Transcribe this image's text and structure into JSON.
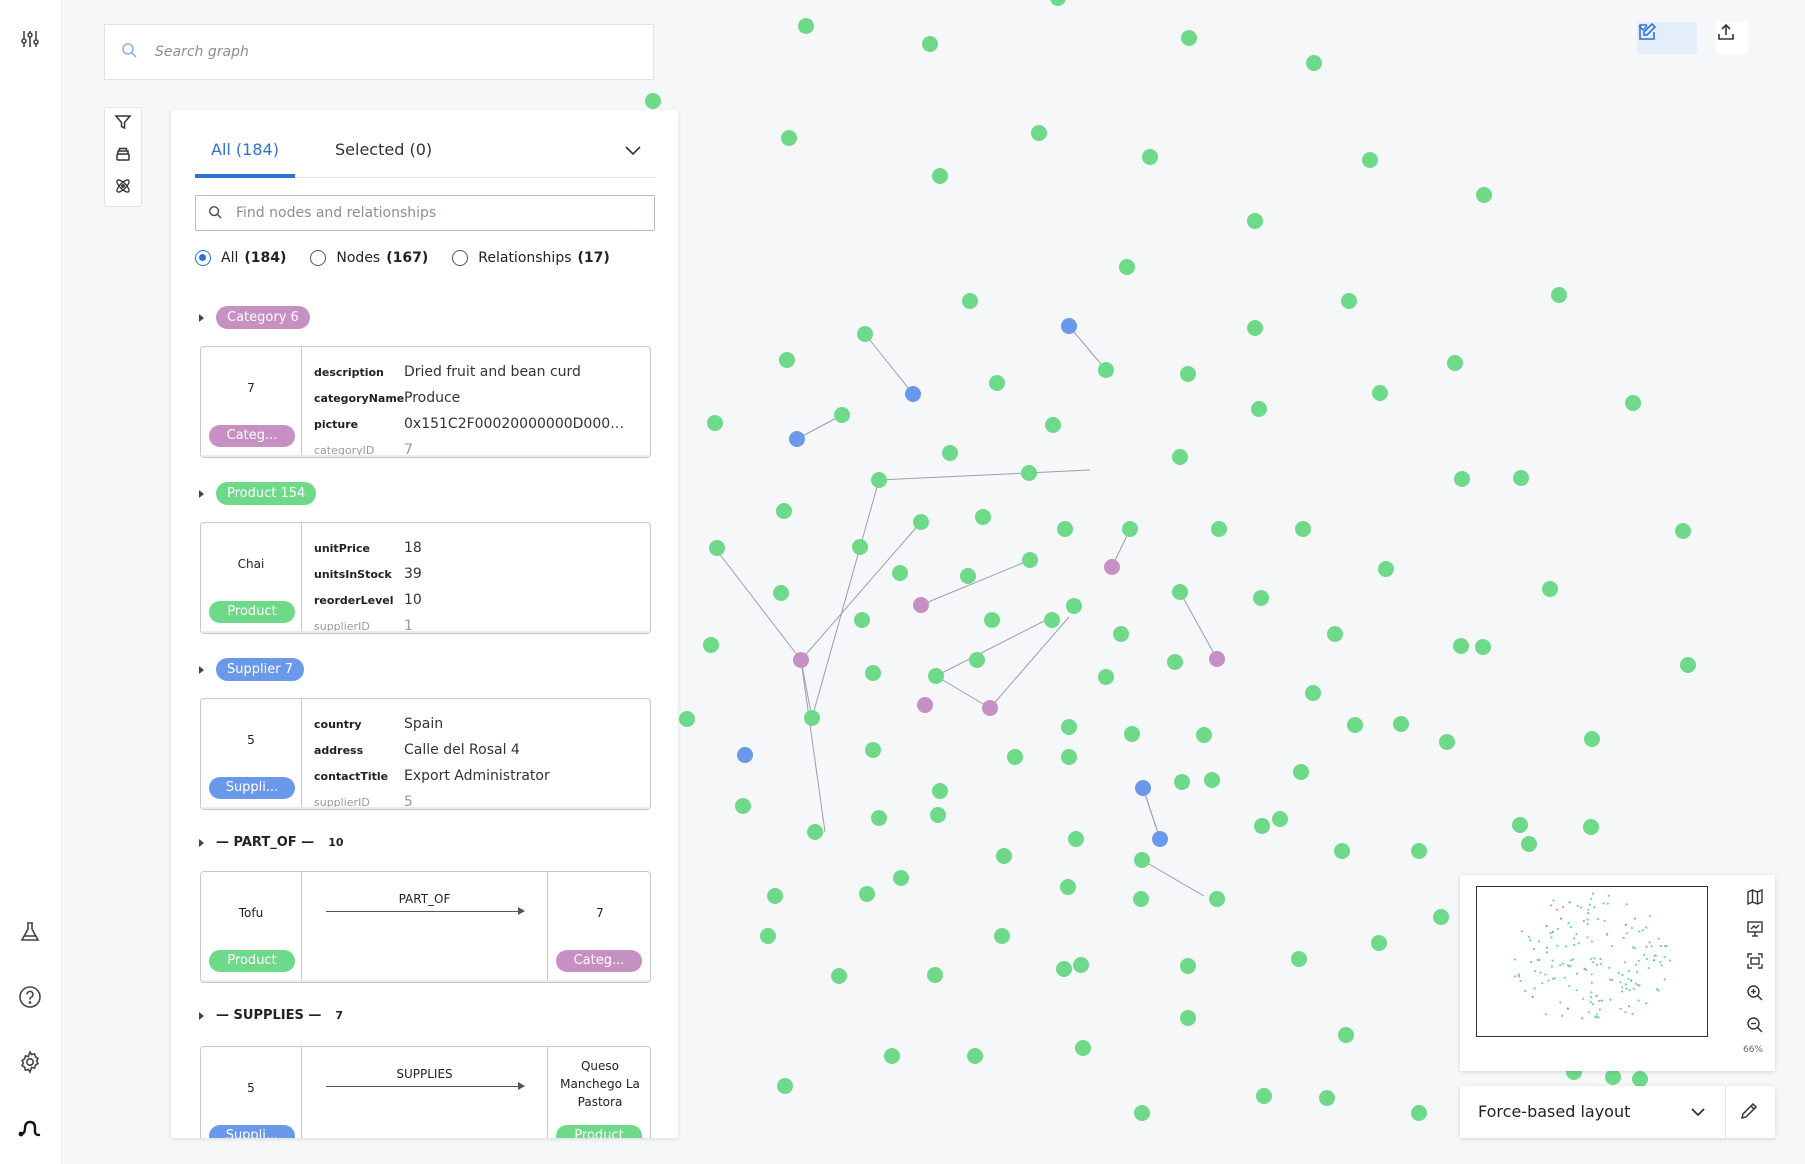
{
  "colors": {
    "category": "#c790c2",
    "product": "#6fd98a",
    "supplier": "#6a99ec",
    "accent": "#2f72d6"
  },
  "graph_search": {
    "placeholder": "Search graph"
  },
  "panel": {
    "tabs": [
      {
        "label": "All (184)",
        "active": true
      },
      {
        "label": "Selected (0)",
        "active": false
      }
    ],
    "find_placeholder": "Find nodes and relationships",
    "filters": [
      {
        "label": "All",
        "count": "(184)",
        "checked": true
      },
      {
        "label": "Nodes",
        "count": "(167)",
        "checked": false
      },
      {
        "label": "Relationships",
        "count": "(17)",
        "checked": false
      }
    ],
    "groups": {
      "category": {
        "pill": "Category 6",
        "card": {
          "caption": "7",
          "label": "Categ...",
          "props": [
            {
              "k": "description",
              "v": "Dried fruit and bean curd"
            },
            {
              "k": "categoryName",
              "v": "Produce"
            },
            {
              "k": "picture",
              "v": "0x151C2F00020000000D000E..."
            },
            {
              "k": "categoryID",
              "v": "7"
            }
          ]
        }
      },
      "product": {
        "pill": "Product 154",
        "card": {
          "caption": "Chai",
          "label": "Product",
          "props": [
            {
              "k": "unitPrice",
              "v": "18"
            },
            {
              "k": "unitsInStock",
              "v": "39"
            },
            {
              "k": "reorderLevel",
              "v": "10"
            },
            {
              "k": "supplierID",
              "v": "1"
            }
          ]
        }
      },
      "supplier": {
        "pill": "Supplier 7",
        "card": {
          "caption": "5",
          "label": "Suppli...",
          "props": [
            {
              "k": "country",
              "v": "Spain"
            },
            {
              "k": "address",
              "v": "Calle del Rosal 4"
            },
            {
              "k": "contactTitle",
              "v": "Export Administrator"
            },
            {
              "k": "supplierID",
              "v": "5"
            }
          ]
        }
      },
      "part_of": {
        "head": "— PART_OF —",
        "count": "10",
        "card": {
          "from_caption": "Tofu",
          "from_label": "Product",
          "type": "PART_OF",
          "to_caption": "7",
          "to_label": "Categ..."
        }
      },
      "supplies": {
        "head": "— SUPPLIES —",
        "count": "7",
        "card": {
          "from_caption": "5",
          "from_label": "Suppli...",
          "type": "SUPPLIES",
          "to_caption_l1": "Queso",
          "to_caption_l2": "Manchego La",
          "to_caption_l3": "Pastora",
          "to_label": "Product"
        }
      }
    }
  },
  "minimap": {
    "zoom": "66%"
  },
  "layout_select": {
    "value": "Force-based layout"
  },
  "icons": {
    "rail": [
      "sliders-icon",
      "flask-icon",
      "help-icon",
      "settings-icon",
      "logo-icon"
    ],
    "toolstrip": [
      "filter-icon",
      "stack-icon",
      "atom-icon"
    ],
    "top_right": [
      "edit-icon",
      "export-icon"
    ],
    "minimap": [
      "map-icon",
      "presentation-icon",
      "fit-icon",
      "zoom-in-icon",
      "zoom-out-icon"
    ]
  }
}
